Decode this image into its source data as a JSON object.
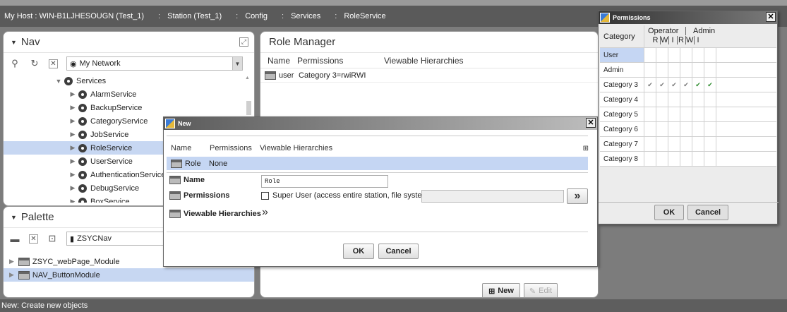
{
  "breadcrumb": [
    "My Host : WIN-B1LJHESOUGN (Test_1)",
    "Station (Test_1)",
    "Config",
    "Services",
    "RoleService"
  ],
  "breadcrumb_sep": ":",
  "nav": {
    "title": "Nav",
    "network_select": "My Network",
    "tree": [
      {
        "label": "Services",
        "level": 0,
        "expanded": true
      },
      {
        "label": "AlarmService",
        "level": 1
      },
      {
        "label": "BackupService",
        "level": 1
      },
      {
        "label": "CategoryService",
        "level": 1
      },
      {
        "label": "JobService",
        "level": 1
      },
      {
        "label": "RoleService",
        "level": 1,
        "selected": true
      },
      {
        "label": "UserService",
        "level": 1
      },
      {
        "label": "AuthenticationService",
        "level": 1
      },
      {
        "label": "DebugService",
        "level": 1
      },
      {
        "label": "BoxService",
        "level": 1
      }
    ]
  },
  "palette": {
    "title": "Palette",
    "select": "ZSYCNav",
    "items": [
      {
        "label": "ZSYC_webPage_Module",
        "selected": false
      },
      {
        "label": "NAV_ButtonModule",
        "selected": true
      }
    ]
  },
  "role_manager": {
    "title": "Role Manager",
    "columns": [
      "Name",
      "Permissions",
      "Viewable Hierarchies"
    ],
    "rows": [
      {
        "name": "user",
        "permissions": "Category 3=rwiRWI",
        "hierarchies": ""
      }
    ],
    "new_label": "New",
    "edit_label": "Edit"
  },
  "new_dialog": {
    "title": "New",
    "columns": [
      "Name",
      "Permissions",
      "Viewable Hierarchies"
    ],
    "row": {
      "name": "Role",
      "permissions": "None"
    },
    "name_label": "Name",
    "name_value": "Role",
    "permissions_label": "Permissions",
    "super_user_label": "Super User (access entire station, file system)",
    "hierarchies_label": "Viewable Hierarchies",
    "ok": "OK",
    "cancel": "Cancel"
  },
  "permissions_dialog": {
    "title": "Permissions",
    "category_header": "Category",
    "group_operator": "Operator",
    "group_admin": "Admin",
    "sub_header": [
      "R",
      "W",
      "I",
      "R",
      "W",
      "I"
    ],
    "rows": [
      {
        "label": "User",
        "checks": [
          false,
          false,
          false,
          false,
          false,
          false
        ],
        "selected": true
      },
      {
        "label": "Admin",
        "checks": [
          false,
          false,
          false,
          false,
          false,
          false
        ]
      },
      {
        "label": "Category 3",
        "checks": [
          true,
          true,
          true,
          true,
          true,
          true
        ]
      },
      {
        "label": "Category 4",
        "checks": [
          false,
          false,
          false,
          false,
          false,
          false
        ]
      },
      {
        "label": "Category 5",
        "checks": [
          false,
          false,
          false,
          false,
          false,
          false
        ]
      },
      {
        "label": "Category 6",
        "checks": [
          false,
          false,
          false,
          false,
          false,
          false
        ]
      },
      {
        "label": "Category 7",
        "checks": [
          false,
          false,
          false,
          false,
          false,
          false
        ]
      },
      {
        "label": "Category 8",
        "checks": [
          false,
          false,
          false,
          false,
          false,
          false
        ]
      }
    ],
    "ok": "OK",
    "cancel": "Cancel"
  },
  "status_bar": "New: Create new objects",
  "colors": {
    "selection": "#c5d6f3",
    "chrome": "#5a5a5a"
  }
}
